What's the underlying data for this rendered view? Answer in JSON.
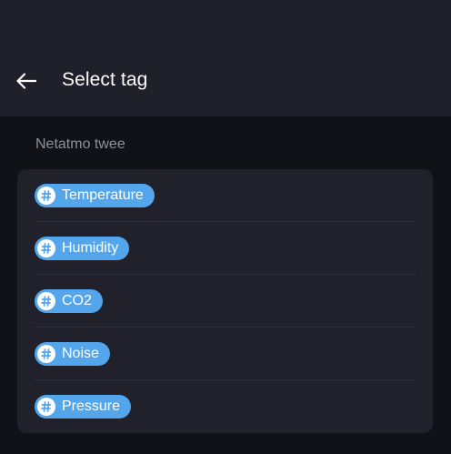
{
  "header": {
    "title": "Select tag",
    "back_icon": "arrow-left-icon"
  },
  "section": {
    "title": "Netatmo twee"
  },
  "tags": [
    {
      "label": "Temperature",
      "icon": "hash-icon"
    },
    {
      "label": "Humidity",
      "icon": "hash-icon"
    },
    {
      "label": "CO2",
      "icon": "hash-icon"
    },
    {
      "label": "Noise",
      "icon": "hash-icon"
    },
    {
      "label": "Pressure",
      "icon": "hash-icon"
    }
  ],
  "colors": {
    "background": "#111217",
    "app_bar": "#1f2029",
    "card": "#20212a",
    "chip": "#53a6ec",
    "secondary_text": "#8f9199"
  }
}
